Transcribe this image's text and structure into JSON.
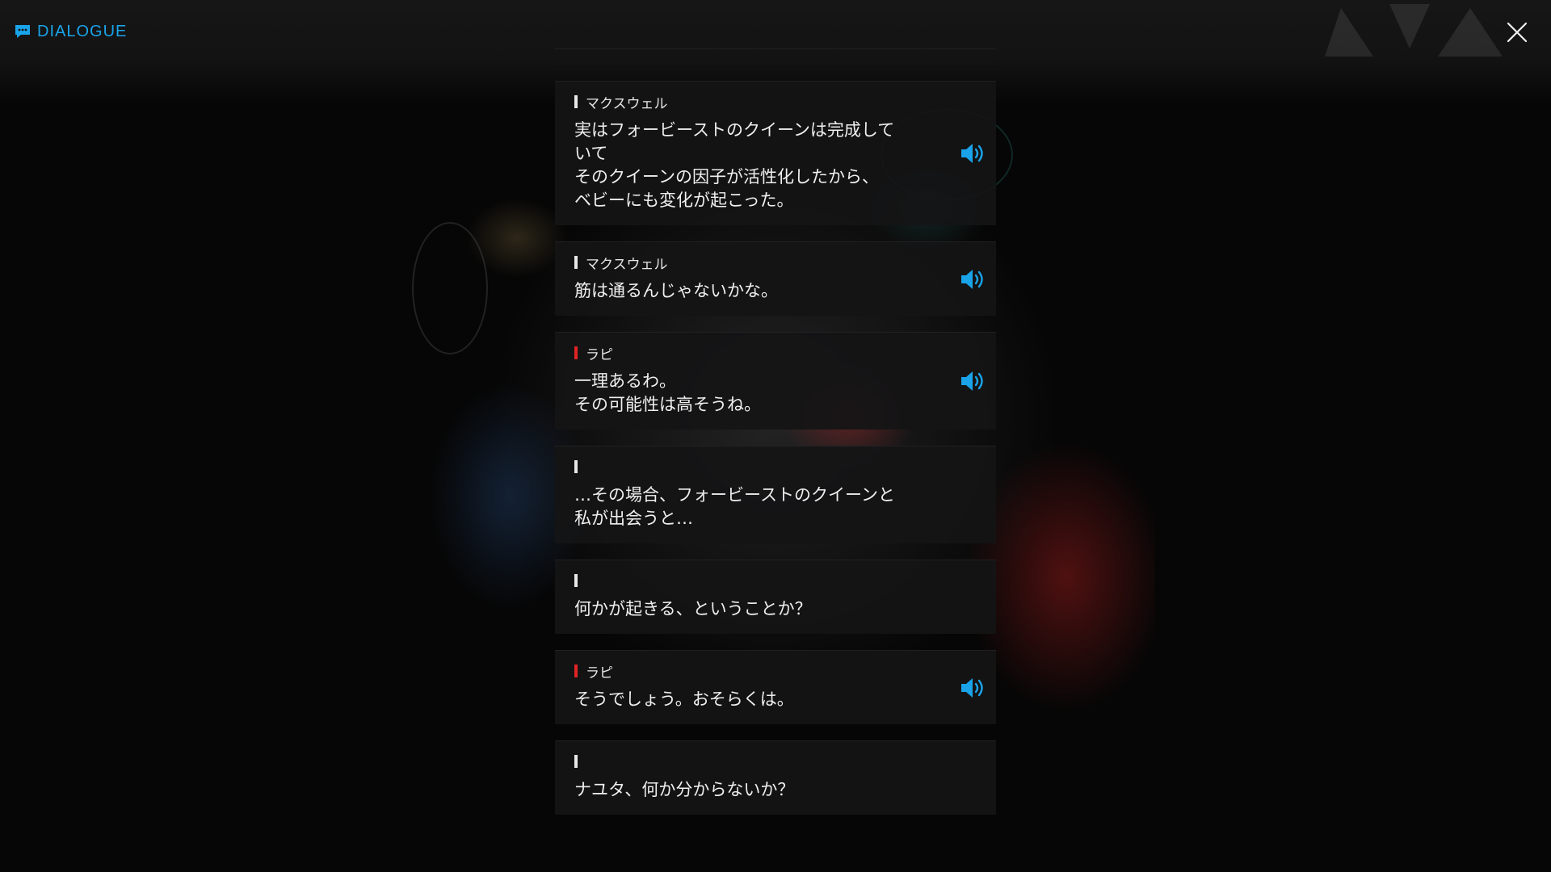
{
  "header": {
    "title": "DIALOGUE",
    "icon": "chat-bubble-icon",
    "accent": "#1aa3e8"
  },
  "close_icon": "close-icon",
  "colors": {
    "speaker_bar_default": "#e8e8e8",
    "speaker_bar_rapi": "#e02424",
    "voice_icon": "#1aa3e8"
  },
  "messages": [
    {
      "speaker": "マクスウェル",
      "bar": "white",
      "text": "実はフォービーストのクイーンは完成していて\nそのクイーンの因子が活性化したから、\nベビーにも変化が起こった。",
      "has_voice": true
    },
    {
      "speaker": "マクスウェル",
      "bar": "white",
      "text": "筋は通るんじゃないかな。",
      "has_voice": true
    },
    {
      "speaker": "ラピ",
      "bar": "red",
      "text": "一理あるわ。\nその可能性は高そうね。",
      "has_voice": true
    },
    {
      "speaker": "",
      "bar": "white",
      "text": "…その場合、フォービーストのクイーンと\n私が出会うと…",
      "has_voice": false
    },
    {
      "speaker": "",
      "bar": "white",
      "text": "何かが起きる、ということか？",
      "has_voice": false
    },
    {
      "speaker": "ラピ",
      "bar": "red",
      "text": "そうでしょう。おそらくは。",
      "has_voice": true
    },
    {
      "speaker": "",
      "bar": "white",
      "text": "ナユタ、何か分からないか？",
      "has_voice": false
    }
  ]
}
